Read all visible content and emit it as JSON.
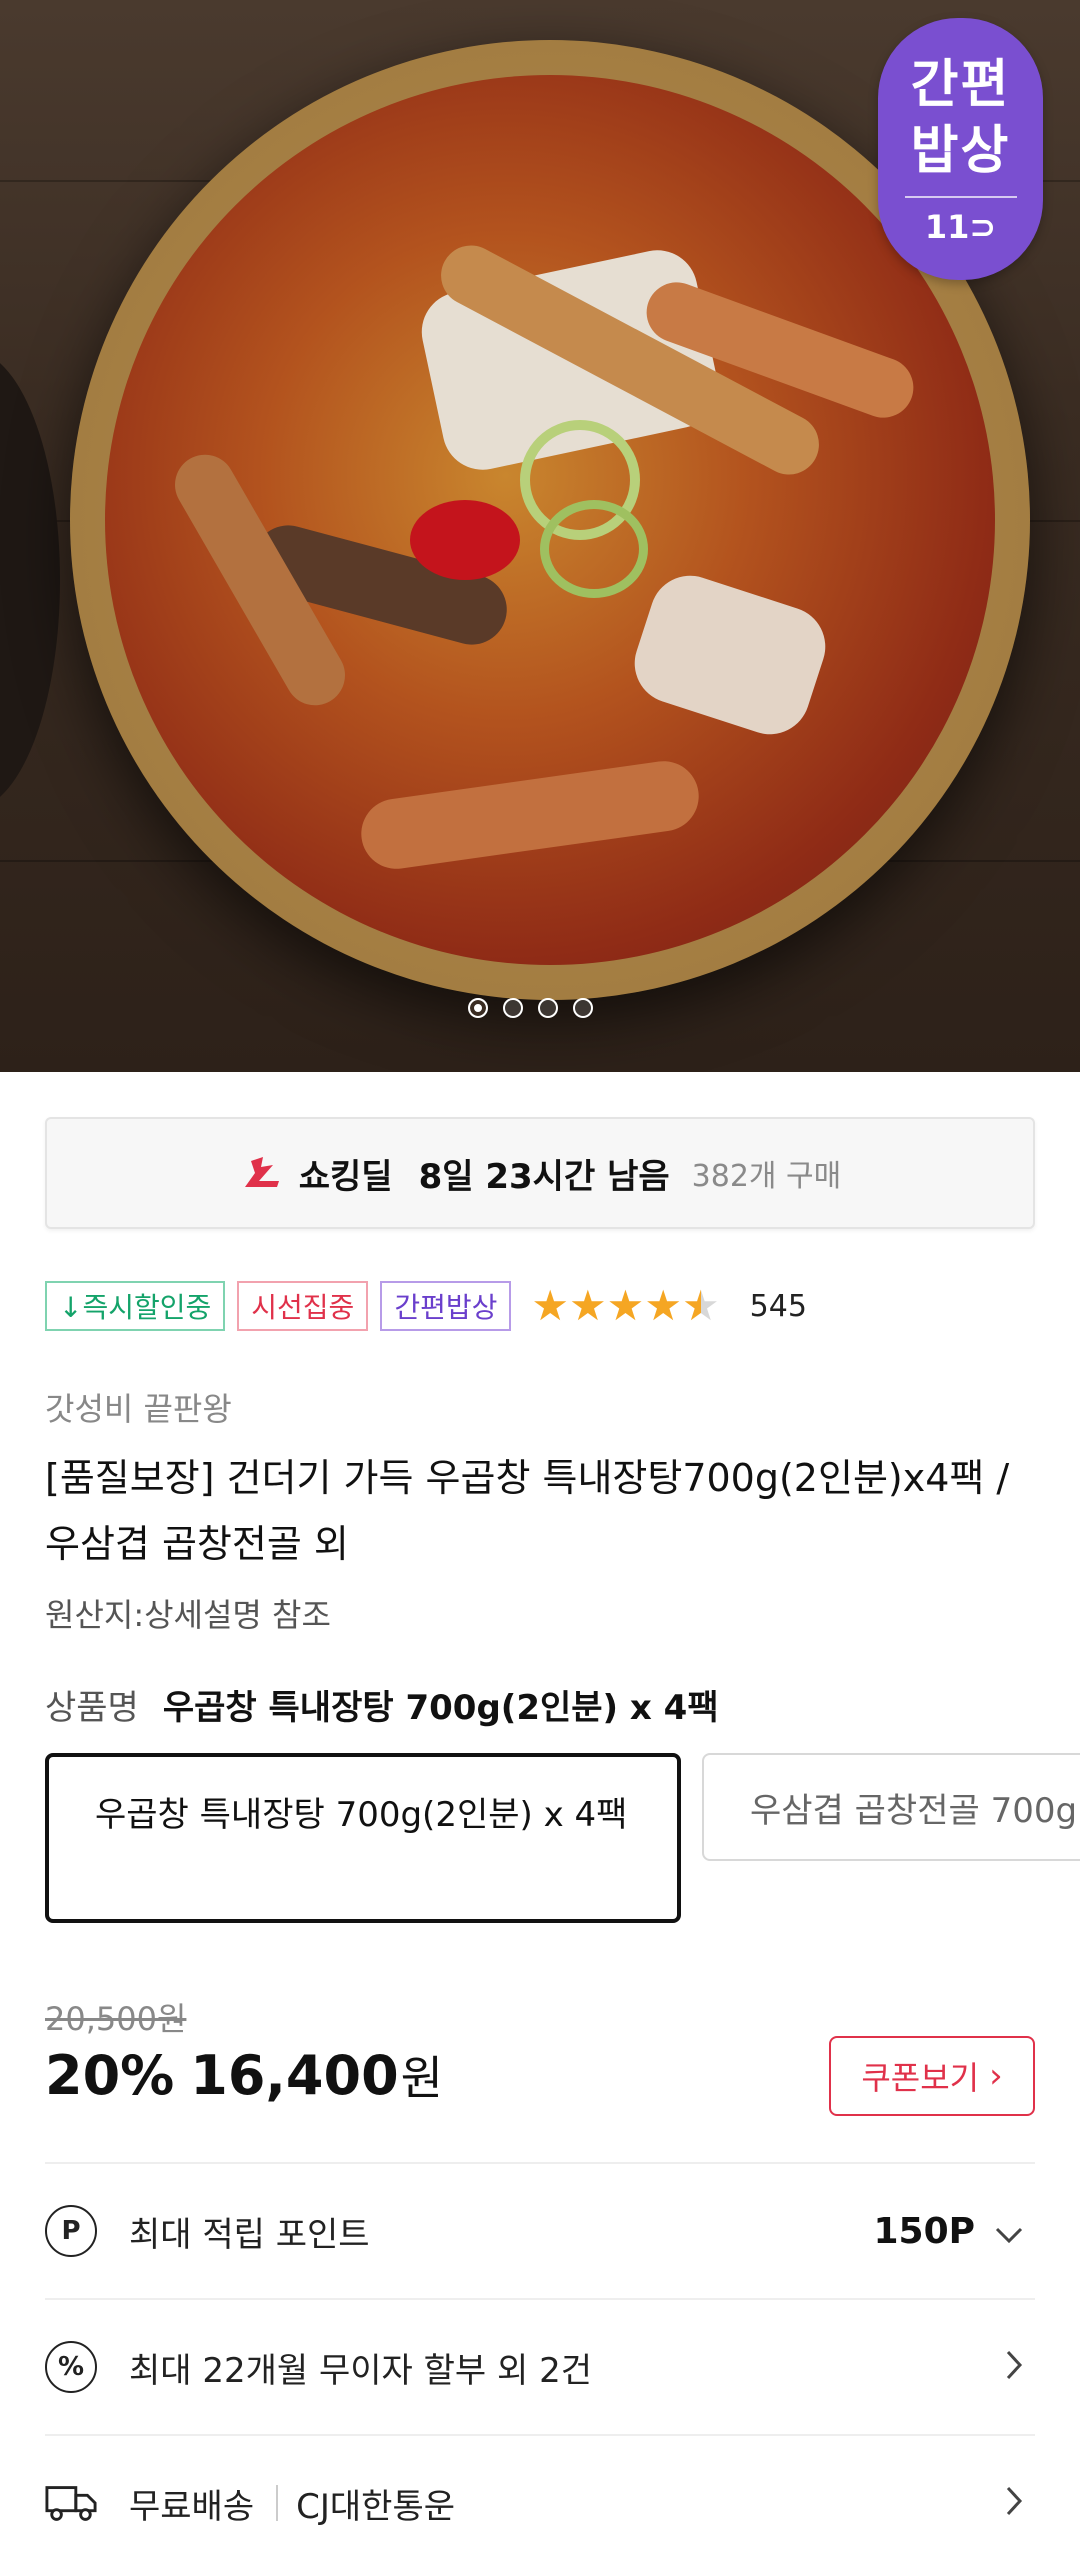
{
  "hero": {
    "badge": {
      "line1": "간편",
      "line2": "밥상",
      "line3": "11⊃"
    },
    "slide_count": 4,
    "active_slide": 1
  },
  "deal": {
    "title": "쇼킹딜",
    "time_left": "8일 23시간 남음",
    "purchases": "382개 구매"
  },
  "tags": [
    "↓즉시할인중",
    "시선집중",
    "간편밥상"
  ],
  "rating": {
    "stars": 4.5,
    "reviews": "545"
  },
  "product": {
    "brand": "갓성비 끝판왕",
    "title": "[품질보장] 건더기 가득 우곱창 특내장탕700g(2인분)x4팩 / 우삼겹 곱창전골 외",
    "origin": "원산지:상세설명 참조",
    "option_label": "상품명",
    "option_selected": "우곱창 특내장탕 700g(2인분) x 4팩",
    "options": [
      "우곱창 특내장탕 700g(2인분) x 4팩",
      "우삼겹 곱창전골 700g"
    ]
  },
  "price": {
    "original": "20,500원",
    "discount": "20%",
    "sale": "16,400",
    "currency": "원",
    "coupon_button": "쿠폰보기"
  },
  "info_rows": {
    "points_label": "최대 적립 포인트",
    "points_value": "150P",
    "installment_label": "최대 22개월 무이자 할부 외 2건",
    "shipping_label": "무료배송",
    "shipping_carrier": "CJ대한통운"
  },
  "colors": {
    "accent_red": "#e0314a",
    "badge_purple": "#7a4fd0",
    "tag_green": "#14a36a",
    "star": "#f5a623"
  }
}
